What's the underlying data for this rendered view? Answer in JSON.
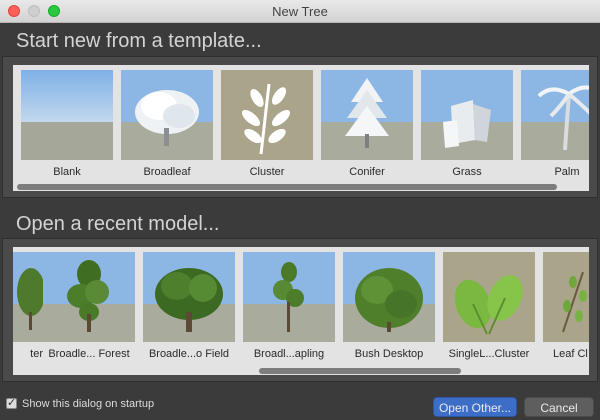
{
  "window": {
    "title": "New Tree"
  },
  "templates": {
    "heading": "Start new from a template...",
    "items": [
      {
        "label": "Blank",
        "icon": "blank-sky-icon"
      },
      {
        "label": "Broadleaf",
        "icon": "broadleaf-tree-icon"
      },
      {
        "label": "Cluster",
        "icon": "cluster-leaves-icon"
      },
      {
        "label": "Conifer",
        "icon": "conifer-tree-icon"
      },
      {
        "label": "Grass",
        "icon": "grass-shapes-icon"
      },
      {
        "label": "Palm",
        "icon": "palm-tree-icon"
      }
    ]
  },
  "recent": {
    "heading": "Open a recent model...",
    "items": [
      {
        "label": "ter",
        "icon": "partial-tree-icon"
      },
      {
        "label": "Broadle... Forest",
        "icon": "forest-tree-icon"
      },
      {
        "label": "Broadle...o Field",
        "icon": "field-tree-icon"
      },
      {
        "label": "Broadl...apling",
        "icon": "sapling-tree-icon"
      },
      {
        "label": "Bush Desktop",
        "icon": "bush-icon"
      },
      {
        "label": "SingleL...Cluster",
        "icon": "single-leaf-cluster-icon"
      },
      {
        "label": "Leaf Cl",
        "icon": "leaf-cluster-icon"
      }
    ]
  },
  "footer": {
    "show_on_startup_label": "Show this dialog on startup",
    "show_on_startup_checked": true,
    "open_other_label": "Open Other...",
    "cancel_label": "Cancel"
  },
  "colors": {
    "sky": "#8fb8e6",
    "ground": "#a9ab9d",
    "accent": "#3d6ec7"
  }
}
